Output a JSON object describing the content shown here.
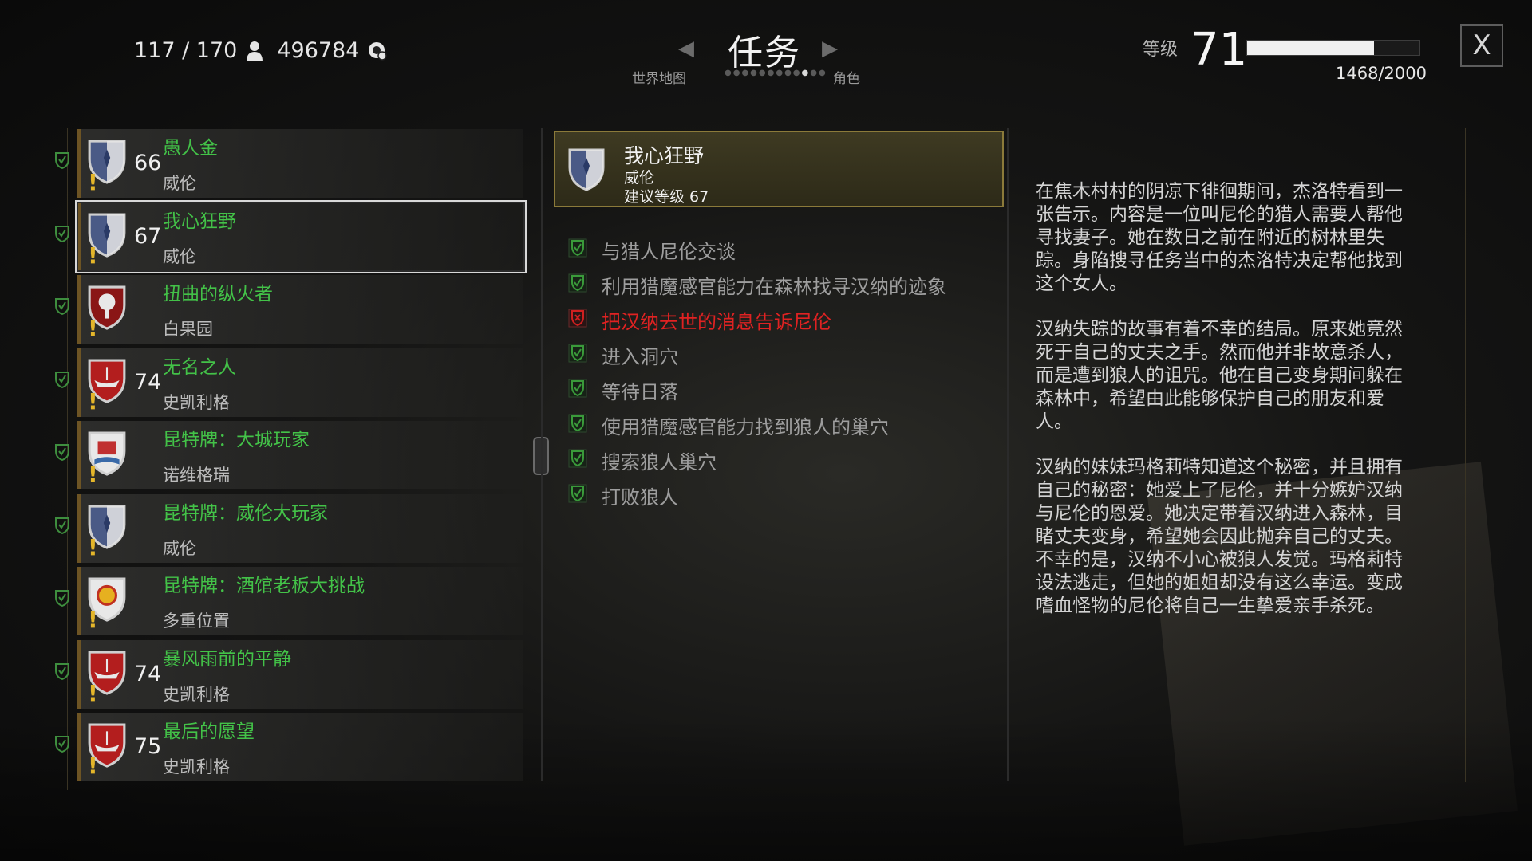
{
  "header": {
    "inventory_count": "117 / 170",
    "crowns": "496784",
    "title": "任务",
    "left_tab": "世界地图",
    "right_tab": "角色",
    "level_label": "等级",
    "level_value": "71",
    "xp_text": "1468/2000",
    "xp_fraction": 0.734,
    "close_label": "X"
  },
  "quests": [
    {
      "name": "愚人金",
      "region": "威伦",
      "level": "66",
      "shield": "velen"
    },
    {
      "name": "我心狂野",
      "region": "威伦",
      "level": "67",
      "shield": "velen",
      "selected": true
    },
    {
      "name": "扭曲的纵火者",
      "region": "白果园",
      "level": "",
      "shield": "orchard"
    },
    {
      "name": "无名之人",
      "region": "史凯利格",
      "level": "74",
      "shield": "skellige"
    },
    {
      "name": "昆特牌：大城玩家",
      "region": "诺维格瑞",
      "level": "",
      "shield": "novigrad"
    },
    {
      "name": "昆特牌：威伦大玩家",
      "region": "威伦",
      "level": "",
      "shield": "velen"
    },
    {
      "name": "昆特牌：酒馆老板大挑战",
      "region": "多重位置",
      "level": "",
      "shield": "sun"
    },
    {
      "name": "暴风雨前的平静",
      "region": "史凯利格",
      "level": "74",
      "shield": "skellige"
    },
    {
      "name": "最后的愿望",
      "region": "史凯利格",
      "level": "75",
      "shield": "skellige"
    }
  ],
  "selected_quest": {
    "name": "我心狂野",
    "region": "威伦",
    "suggested_level": "建议等级 67"
  },
  "objectives": [
    {
      "text": "与猎人尼伦交谈",
      "status": "done"
    },
    {
      "text": "利用猎魔感官能力在森林找寻汉纳的迹象",
      "status": "done"
    },
    {
      "text": "把汉纳去世的消息告诉尼伦",
      "status": "failed"
    },
    {
      "text": "进入洞穴",
      "status": "done"
    },
    {
      "text": "等待日落",
      "status": "done"
    },
    {
      "text": "使用猎魔感官能力找到狼人的巢穴",
      "status": "done"
    },
    {
      "text": "搜索狼人巢穴",
      "status": "done"
    },
    {
      "text": "打败狼人",
      "status": "done"
    }
  ],
  "description": [
    "在焦木村村的阴凉下徘徊期间，杰洛特看到一张告示。内容是一位叫尼伦的猎人需要人帮他寻找妻子。她在数日之前在附近的树林里失踪。身陷搜寻任务当中的杰洛特决定帮他找到这个女人。",
    "汉纳失踪的故事有着不幸的结局。原来她竟然死于自己的丈夫之手。然而他并非故意杀人，而是遭到狼人的诅咒。他在自己变身期间躲在森林中，希望由此能够保护自己的朋友和爱人。",
    "汉纳的妹妹玛格莉特知道这个秘密，并且拥有自己的秘密：她爱上了尼伦，并十分嫉妒汉纳与尼伦的恩爱。她决定带着汉纳进入森林，目睹丈夫变身，希望她会因此抛弃自己的丈夫。不幸的是，汉纳不小心被狼人发觉。玛格莉特设法逃走，但她的姐姐却没有这么幸运。变成嗜血怪物的尼伦将自己一生挚爱亲手杀死。"
  ],
  "colors": {
    "quest_name": "#43c248",
    "failed": "#e02222",
    "done_check": "#3a9a3a",
    "exclamation": "#e4b62a",
    "header_border": "#8b7a3a"
  }
}
